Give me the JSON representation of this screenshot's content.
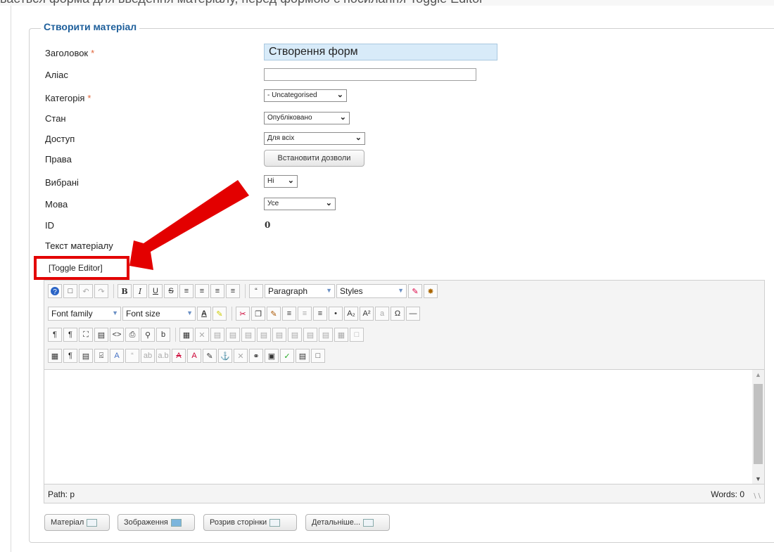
{
  "top_text": "вається форма для введення матеріалу, перед формою є посилання Toggle Editor",
  "legend": "Створити матеріал",
  "fields": {
    "title_label": "Заголовок",
    "title_value": "Створення форм",
    "alias_label": "Аліас",
    "category_label": "Категорія",
    "category_value": "- Uncategorised",
    "state_label": "Стан",
    "state_value": "Опубліковано",
    "access_label": "Доступ",
    "access_value": "Для всіх",
    "rights_label": "Права",
    "rights_button": "Встановити дозволи",
    "featured_label": "Вибрані",
    "featured_value": "Ні",
    "language_label": "Мова",
    "language_value": "Усе",
    "id_label": "ID",
    "id_value": "0",
    "text_label": "Текст матеріалу",
    "required_mark": "*"
  },
  "toggle_editor": "[Toggle Editor]",
  "editor": {
    "format_select": "Paragraph",
    "styles_select": "Styles",
    "font_family": "Font family",
    "font_size": "Font size",
    "path": "Path: p",
    "words": "Words: 0"
  },
  "buttons": {
    "article": "Матеріал",
    "image": "Зображення",
    "page_break": "Розрив сторінки",
    "read_more": "Детальніше..."
  },
  "colors": {
    "annotation_red": "#e30000",
    "legend_blue": "#1e5f9b",
    "title_field_bg": "#d8ebf9"
  }
}
